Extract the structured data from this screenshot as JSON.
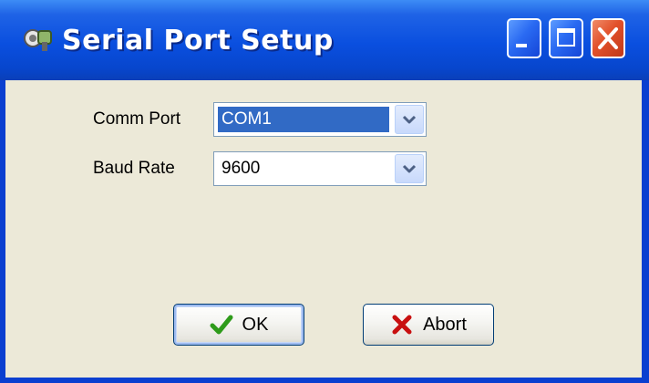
{
  "window": {
    "title": "Serial Port Setup",
    "caption_buttons": [
      "minimize",
      "maximize",
      "close"
    ]
  },
  "form": {
    "comm_port": {
      "label": "Comm Port",
      "value": "COM1"
    },
    "baud_rate": {
      "label": "Baud Rate",
      "value": "9600"
    }
  },
  "buttons": {
    "ok": {
      "label": "OK",
      "icon": "checkmark-icon"
    },
    "abort": {
      "label": "Abort",
      "icon": "x-icon"
    }
  },
  "colors": {
    "titlebar": "#0a4fdf",
    "client_bg": "#ece9d8",
    "selection": "#316ac5",
    "close_button": "#e2502a",
    "ok_check": "#2e9b1a",
    "abort_x": "#c81010"
  }
}
